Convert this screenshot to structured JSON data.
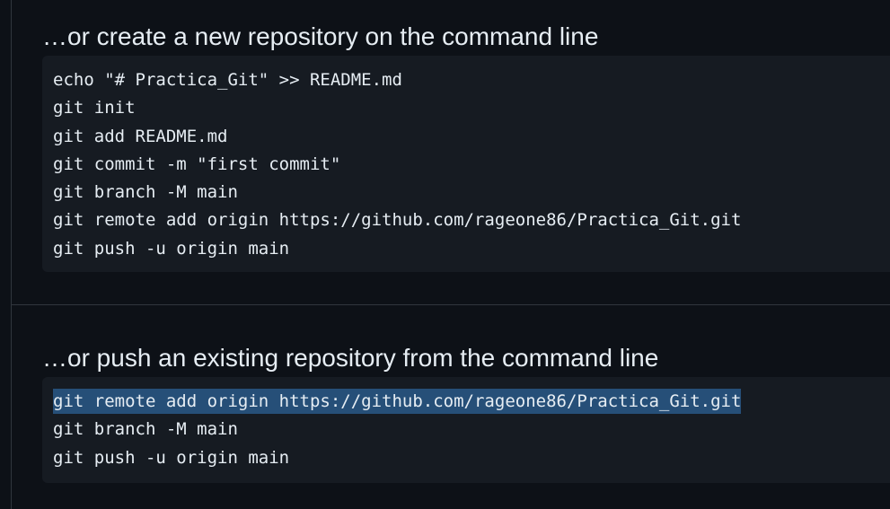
{
  "sections": [
    {
      "heading": "…or create a new repository on the command line",
      "lines": [
        "echo \"# Practica_Git\" >> README.md",
        "git init",
        "git add README.md",
        "git commit -m \"first commit\"",
        "git branch -M main",
        "git remote add origin https://github.com/rageone86/Practica_Git.git",
        "git push -u origin main"
      ]
    },
    {
      "heading": "…or push an existing repository from the command line",
      "lines": [
        "git remote add origin https://github.com/rageone86/Practica_Git.git",
        "git branch -M main",
        "git push -u origin main"
      ],
      "selected_line_index": 0
    }
  ],
  "colors": {
    "background": "#0d1117",
    "code_background": "#161b22",
    "text": "#e6edf3",
    "border": "#30363d",
    "selection": "#264f78"
  }
}
